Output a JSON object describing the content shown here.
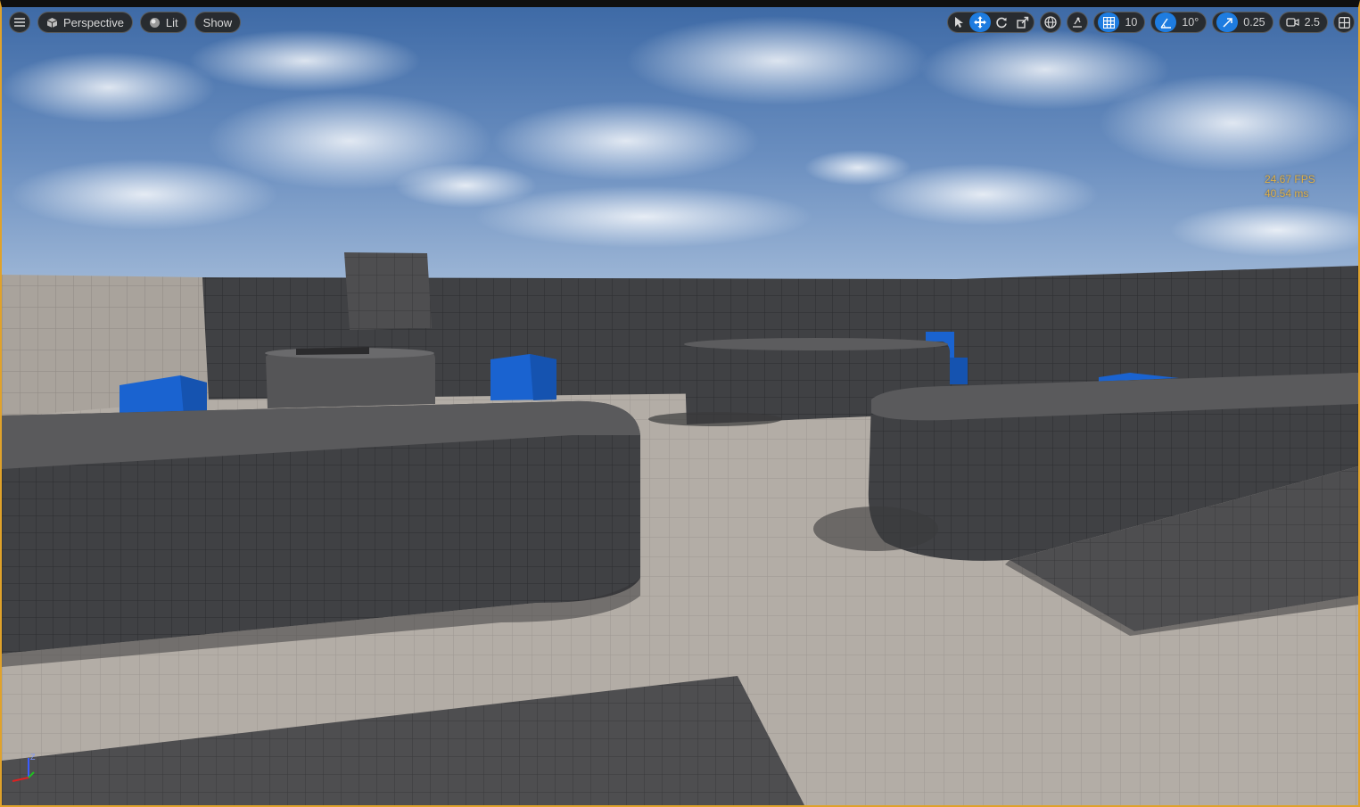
{
  "viewport": {
    "view_mode": "Perspective",
    "lighting_mode": "Lit",
    "show_label": "Show",
    "highlight_color": "#e0a22a",
    "accent_color": "#1e7ce0"
  },
  "toolbar": {
    "grid_snap_value": "10",
    "rotation_snap_value": "10°",
    "scale_snap_value": "0.25",
    "camera_speed_value": "2.5",
    "icons": [
      "menu-icon",
      "perspective-cube-icon",
      "lit-sphere-icon",
      "select-arrow-icon",
      "translate-move-icon",
      "rotate-icon",
      "scale-icon",
      "world-local-globe-icon",
      "surface-snap-icon",
      "grid-snap-icon",
      "angle-snap-icon",
      "scale-snap-icon",
      "camera-speed-icon",
      "viewport-layout-icon"
    ]
  },
  "stats": {
    "fps": "24.67 FPS",
    "frame_time": "40.54 ms"
  },
  "axis_gizmo": {
    "z_label": "Z"
  }
}
